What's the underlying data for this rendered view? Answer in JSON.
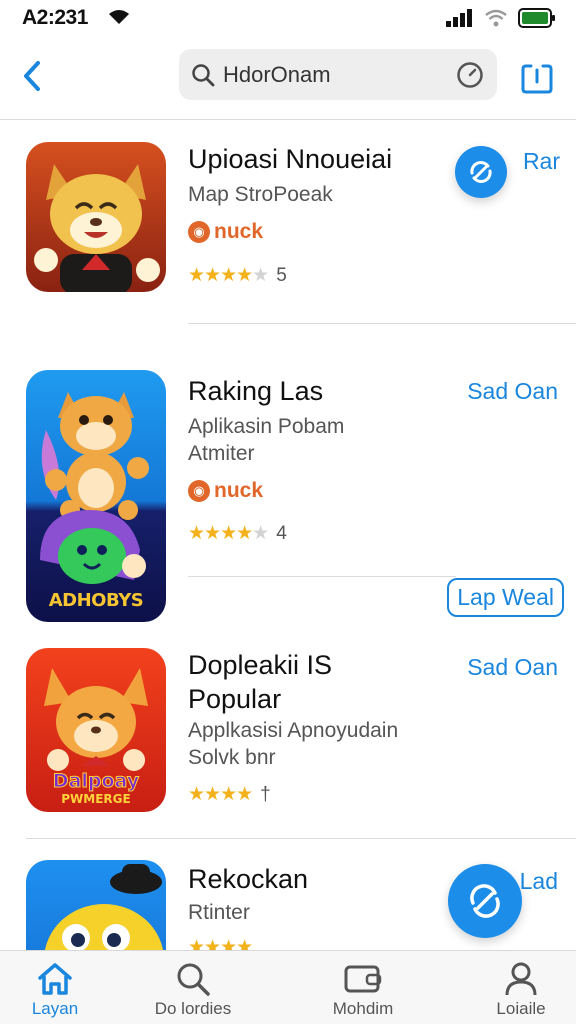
{
  "status": {
    "time": "A2:231"
  },
  "search": {
    "query": "HdorOnam"
  },
  "apps": [
    {
      "title": "Upioasi Nnoueiai",
      "subtitle": "Map StroPoeak",
      "badge": "nuck",
      "rating_text": "5",
      "stars": 4.5,
      "action": "Rar"
    },
    {
      "title": "Raking Las",
      "subtitle": "Aplikasin Pobam",
      "subtitle2": "Atmiter",
      "badge": "nuck",
      "rating_text": "4",
      "stars": 4.5,
      "action": "Sad Oan",
      "icon_text": "ADHOBYS",
      "secondary_action": "Lap Weal"
    },
    {
      "title": "Dopleakii IS",
      "title2": "Popular",
      "subtitle": "Applkasisi Apnoyudain",
      "subtitle2": "Solvk bnr",
      "rating_text": "†",
      "stars": 4,
      "action": "Sad Oan",
      "icon_text": "Dalpoay",
      "icon_text2": "PWMERGE"
    },
    {
      "title": "Rekockan",
      "subtitle": "Rtinter",
      "action": "Lad",
      "stars": 4
    }
  ],
  "tabs": [
    {
      "label": "Layan",
      "icon": "home-icon",
      "active": true
    },
    {
      "label": "Do lordies",
      "icon": "search-icon"
    },
    {
      "label": "Mohdim",
      "icon": "wallet-icon"
    },
    {
      "label": "Loiaile",
      "icon": "person-icon"
    }
  ],
  "colors": {
    "accent": "#1a86dd",
    "badge": "#e0662a",
    "star": "#f3b21c"
  }
}
